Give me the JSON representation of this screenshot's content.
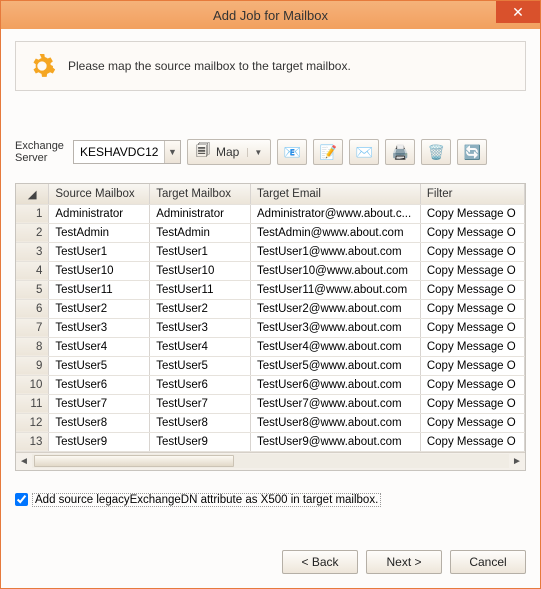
{
  "window": {
    "title": "Add Job for Mailbox"
  },
  "info": {
    "text": "Please map the source mailbox to the target mailbox."
  },
  "exchange": {
    "label1": "Exchange",
    "label2": "Server",
    "value": "KESHAVDC12"
  },
  "map_button": {
    "label": "Map"
  },
  "columns": {
    "source": "Source Mailbox",
    "target": "Target Mailbox",
    "email": "Target Email",
    "filter": "Filter"
  },
  "rows": [
    {
      "n": "1",
      "src": "Administrator",
      "tgt": "Administrator",
      "email": "Administrator@www.about.c...",
      "filter": "Copy Message O"
    },
    {
      "n": "2",
      "src": "TestAdmin",
      "tgt": "TestAdmin",
      "email": "TestAdmin@www.about.com",
      "filter": "Copy Message O"
    },
    {
      "n": "3",
      "src": "TestUser1",
      "tgt": "TestUser1",
      "email": "TestUser1@www.about.com",
      "filter": "Copy Message O"
    },
    {
      "n": "4",
      "src": "TestUser10",
      "tgt": "TestUser10",
      "email": "TestUser10@www.about.com",
      "filter": "Copy Message O"
    },
    {
      "n": "5",
      "src": "TestUser11",
      "tgt": "TestUser11",
      "email": "TestUser11@www.about.com",
      "filter": "Copy Message O"
    },
    {
      "n": "6",
      "src": "TestUser2",
      "tgt": "TestUser2",
      "email": "TestUser2@www.about.com",
      "filter": "Copy Message O"
    },
    {
      "n": "7",
      "src": "TestUser3",
      "tgt": "TestUser3",
      "email": "TestUser3@www.about.com",
      "filter": "Copy Message O"
    },
    {
      "n": "8",
      "src": "TestUser4",
      "tgt": "TestUser4",
      "email": "TestUser4@www.about.com",
      "filter": "Copy Message O"
    },
    {
      "n": "9",
      "src": "TestUser5",
      "tgt": "TestUser5",
      "email": "TestUser5@www.about.com",
      "filter": "Copy Message O"
    },
    {
      "n": "10",
      "src": "TestUser6",
      "tgt": "TestUser6",
      "email": "TestUser6@www.about.com",
      "filter": "Copy Message O"
    },
    {
      "n": "11",
      "src": "TestUser7",
      "tgt": "TestUser7",
      "email": "TestUser7@www.about.com",
      "filter": "Copy Message O"
    },
    {
      "n": "12",
      "src": "TestUser8",
      "tgt": "TestUser8",
      "email": "TestUser8@www.about.com",
      "filter": "Copy Message O"
    },
    {
      "n": "13",
      "src": "TestUser9",
      "tgt": "TestUser9",
      "email": "TestUser9@www.about.com",
      "filter": "Copy Message O"
    }
  ],
  "checkbox": {
    "label": "Add source legacyExchangeDN attribute as X500 in target mailbox.",
    "checked": true
  },
  "buttons": {
    "back": "< Back",
    "next": "Next >",
    "cancel": "Cancel"
  },
  "colors": {
    "accent": "#e67a3c",
    "close": "#d9512c"
  }
}
